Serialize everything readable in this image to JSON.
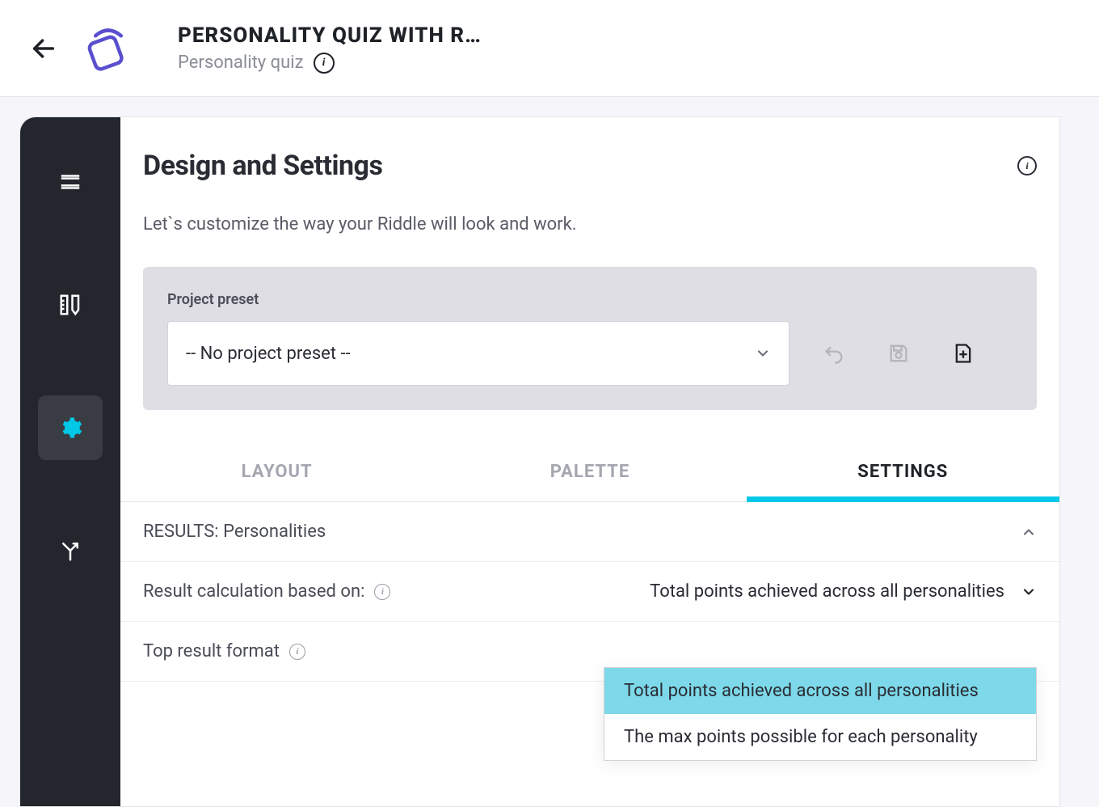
{
  "header": {
    "title": "PERSONALITY QUIZ WITH R…",
    "subtitle": "Personality quiz"
  },
  "main": {
    "title": "Design and Settings",
    "description": "Let`s customize the way your Riddle will look and work."
  },
  "preset": {
    "label": "Project preset",
    "selected": "-- No project preset --"
  },
  "tabs": {
    "layout": "LAYOUT",
    "palette": "PALETTE",
    "settings": "SETTINGS"
  },
  "rows": {
    "results_section": "RESULTS: Personalities",
    "calc_label": "Result calculation based on:",
    "calc_value": "Total points achieved across all personalities",
    "format_label": "Top result format"
  },
  "dropdown": {
    "opt1": "Total points achieved across all personalities",
    "opt2": "The max points possible for each personality"
  }
}
